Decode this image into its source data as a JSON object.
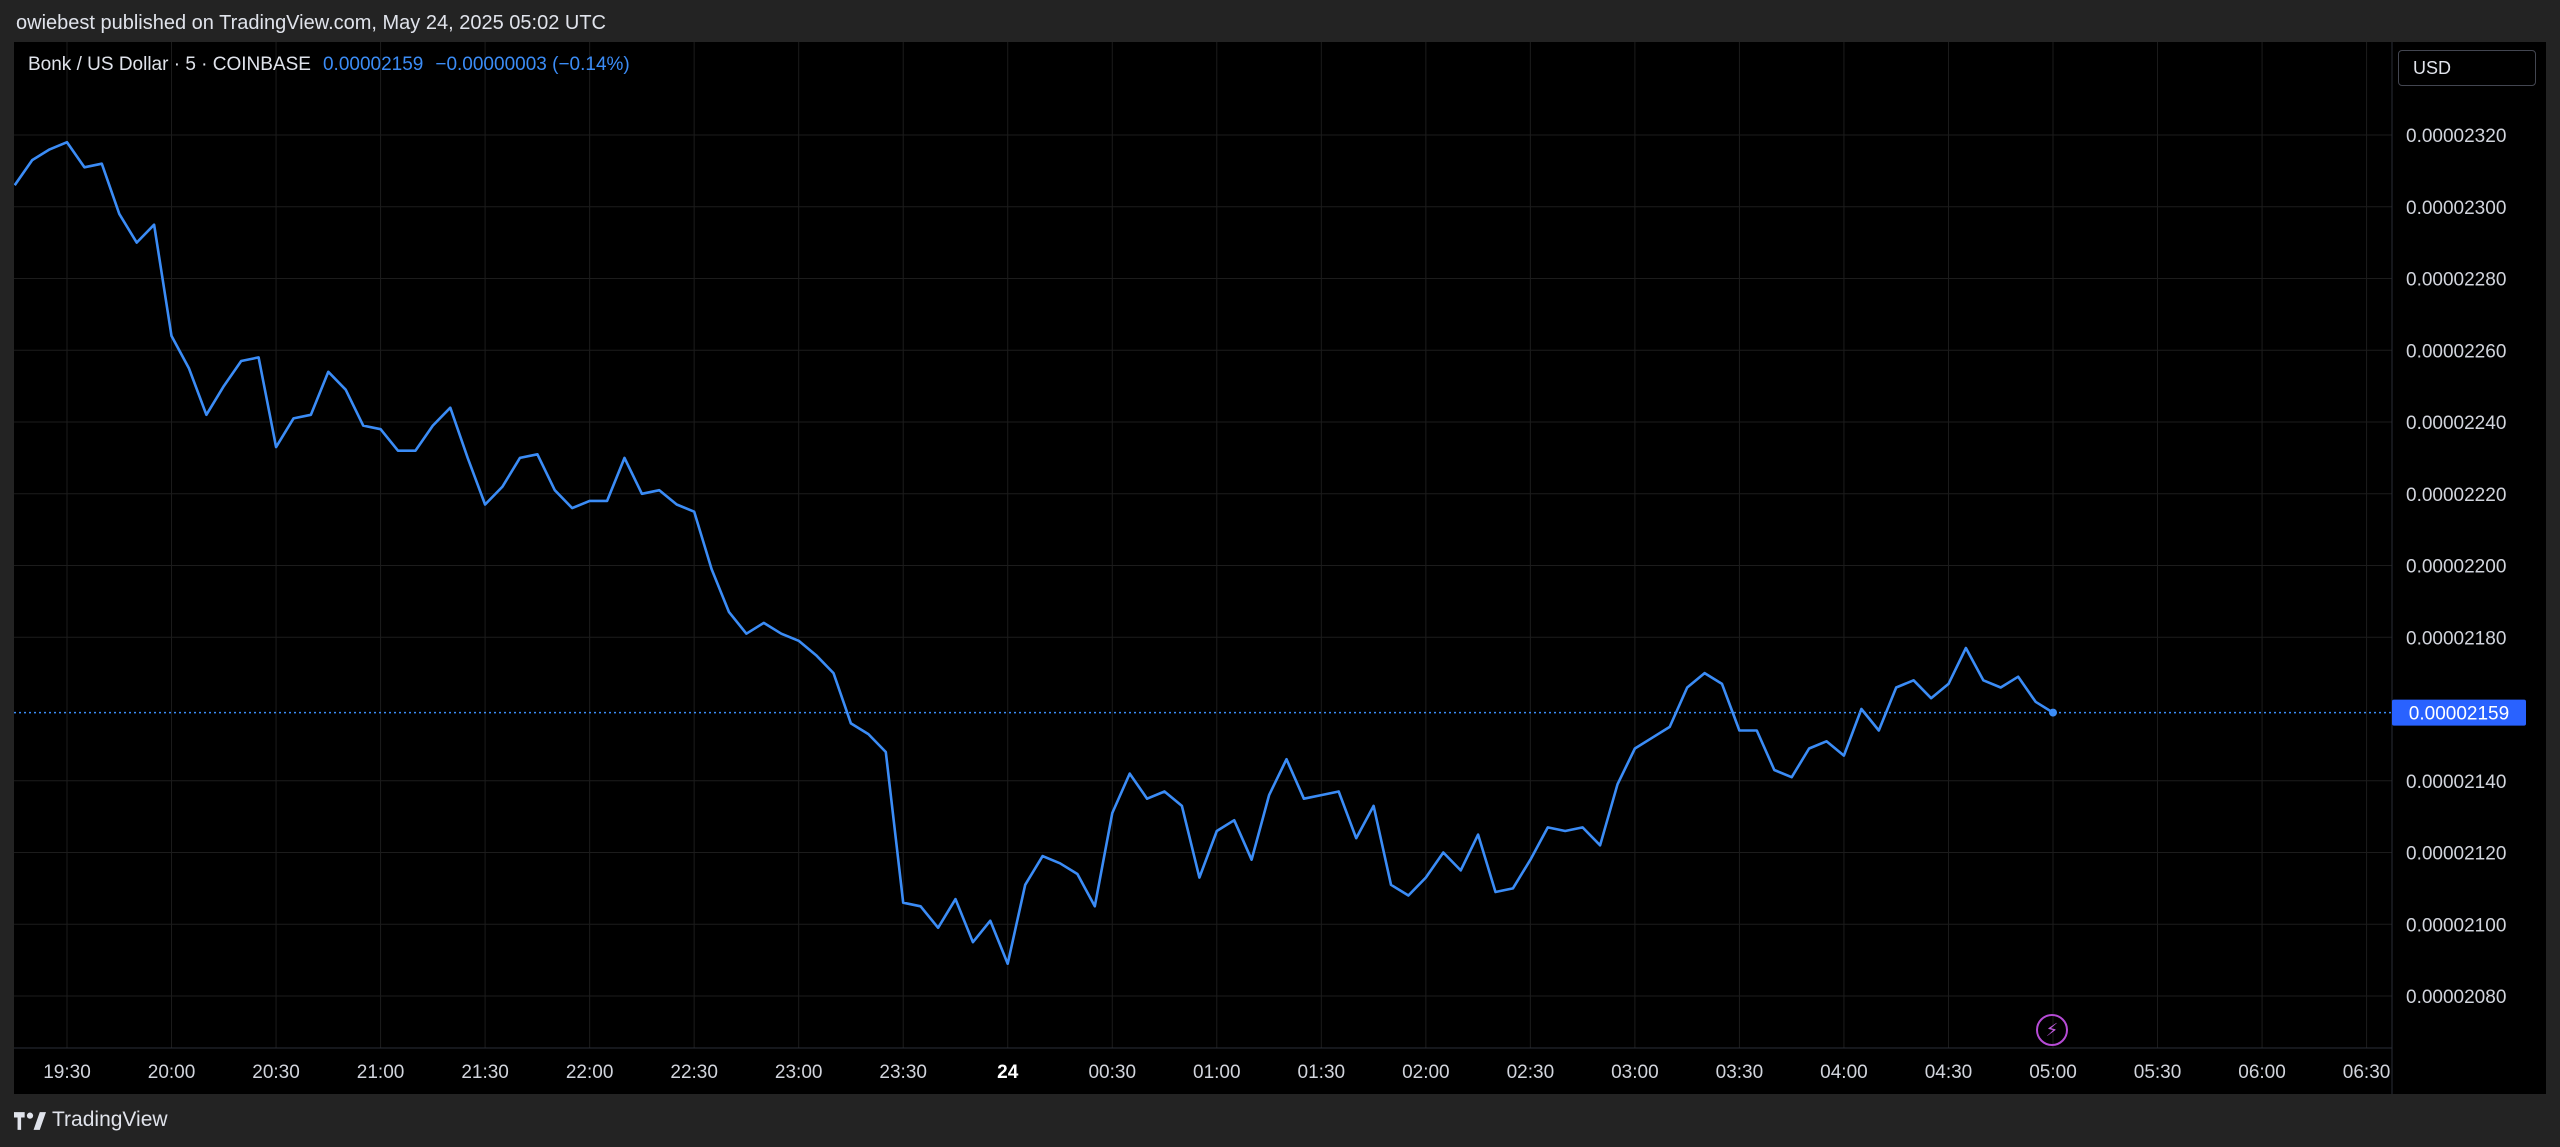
{
  "header": {
    "published_text": "owiebest published on TradingView.com, May 24, 2025 05:02 UTC"
  },
  "legend": {
    "symbol": "Bonk / US Dollar · 5 · COINBASE",
    "price": "0.00002159",
    "change": "−0.00000003 (−0.14%)"
  },
  "currency_selector": {
    "label": "USD"
  },
  "footer": {
    "brand": "TradingView"
  },
  "icons": {
    "flash": "lightning-icon",
    "logo": "tradingview-logo-icon"
  },
  "colors": {
    "line": "#3b8cf6",
    "price_tag": "#2962ff",
    "grid": "#1c1c1c",
    "flash": "#c25ce0"
  },
  "chart_data": {
    "type": "line",
    "title": "",
    "xlabel": "",
    "ylabel": "",
    "ylim": [
      2.07e-05,
      2.33e-05
    ],
    "y_ticks": [
      "0.00002320",
      "0.00002300",
      "0.00002280",
      "0.00002260",
      "0.00002240",
      "0.00002220",
      "0.00002200",
      "0.00002180",
      "0.00002140",
      "0.00002120",
      "0.00002100",
      "0.00002080"
    ],
    "y_tick_values": [
      2.32e-05,
      2.3e-05,
      2.28e-05,
      2.26e-05,
      2.24e-05,
      2.22e-05,
      2.2e-05,
      2.18e-05,
      2.14e-05,
      2.12e-05,
      2.1e-05,
      2.08e-05
    ],
    "x_ticks": [
      "19:30",
      "20:00",
      "20:30",
      "21:00",
      "21:30",
      "22:00",
      "22:30",
      "23:00",
      "23:30",
      "24",
      "00:30",
      "01:00",
      "01:30",
      "02:00",
      "02:30",
      "03:00",
      "03:30",
      "04:00",
      "04:30",
      "05:00",
      "05:30",
      "06:00",
      "06:30"
    ],
    "x_tick_minutes": [
      1170,
      1200,
      1230,
      1260,
      1290,
      1320,
      1350,
      1380,
      1410,
      1440,
      1470,
      1500,
      1530,
      1560,
      1590,
      1620,
      1650,
      1680,
      1710,
      1740,
      1770,
      1800,
      1830
    ],
    "bold_tick": "24",
    "last_price_label": "0.00002159",
    "last_price": 2.159e-05,
    "grid": true,
    "x_minutes": [
      1155,
      1160,
      1165,
      1170,
      1175,
      1180,
      1185,
      1190,
      1195,
      1200,
      1205,
      1210,
      1215,
      1220,
      1225,
      1230,
      1235,
      1240,
      1245,
      1250,
      1255,
      1260,
      1265,
      1270,
      1275,
      1280,
      1285,
      1290,
      1295,
      1300,
      1305,
      1310,
      1315,
      1320,
      1325,
      1330,
      1335,
      1340,
      1345,
      1350,
      1355,
      1360,
      1365,
      1370,
      1375,
      1380,
      1385,
      1390,
      1395,
      1400,
      1405,
      1410,
      1415,
      1420,
      1425,
      1430,
      1435,
      1440,
      1445,
      1450,
      1455,
      1460,
      1465,
      1470,
      1475,
      1480,
      1485,
      1490,
      1495,
      1500,
      1505,
      1510,
      1515,
      1520,
      1525,
      1530,
      1535,
      1540,
      1545,
      1550,
      1555,
      1560,
      1565,
      1570,
      1575,
      1580,
      1585,
      1590,
      1595,
      1600,
      1605,
      1610,
      1615,
      1620,
      1625,
      1630,
      1635,
      1640,
      1645,
      1650,
      1655,
      1660,
      1665,
      1670,
      1675,
      1680,
      1685,
      1690,
      1695,
      1700,
      1705,
      1710,
      1715,
      1720,
      1725,
      1730,
      1735,
      1740
    ],
    "values": [
      2.306e-05,
      2.313e-05,
      2.316e-05,
      2.318e-05,
      2.311e-05,
      2.312e-05,
      2.298e-05,
      2.29e-05,
      2.295e-05,
      2.264e-05,
      2.255e-05,
      2.242e-05,
      2.25e-05,
      2.257e-05,
      2.258e-05,
      2.233e-05,
      2.241e-05,
      2.242e-05,
      2.254e-05,
      2.249e-05,
      2.239e-05,
      2.238e-05,
      2.232e-05,
      2.232e-05,
      2.239e-05,
      2.244e-05,
      2.23e-05,
      2.217e-05,
      2.222e-05,
      2.23e-05,
      2.231e-05,
      2.221e-05,
      2.216e-05,
      2.218e-05,
      2.218e-05,
      2.23e-05,
      2.22e-05,
      2.221e-05,
      2.217e-05,
      2.215e-05,
      2.199e-05,
      2.187e-05,
      2.181e-05,
      2.184e-05,
      2.181e-05,
      2.179e-05,
      2.175e-05,
      2.17e-05,
      2.156e-05,
      2.153e-05,
      2.148e-05,
      2.106e-05,
      2.105e-05,
      2.099e-05,
      2.107e-05,
      2.095e-05,
      2.101e-05,
      2.089e-05,
      2.111e-05,
      2.119e-05,
      2.117e-05,
      2.114e-05,
      2.105e-05,
      2.131e-05,
      2.142e-05,
      2.135e-05,
      2.137e-05,
      2.133e-05,
      2.113e-05,
      2.126e-05,
      2.129e-05,
      2.118e-05,
      2.136e-05,
      2.146e-05,
      2.135e-05,
      2.136e-05,
      2.137e-05,
      2.124e-05,
      2.133e-05,
      2.111e-05,
      2.108e-05,
      2.113e-05,
      2.12e-05,
      2.115e-05,
      2.125e-05,
      2.109e-05,
      2.11e-05,
      2.118e-05,
      2.127e-05,
      2.126e-05,
      2.127e-05,
      2.122e-05,
      2.139e-05,
      2.149e-05,
      2.152e-05,
      2.155e-05,
      2.166e-05,
      2.17e-05,
      2.167e-05,
      2.154e-05,
      2.154e-05,
      2.143e-05,
      2.141e-05,
      2.149e-05,
      2.151e-05,
      2.147e-05,
      2.16e-05,
      2.154e-05,
      2.166e-05,
      2.168e-05,
      2.163e-05,
      2.167e-05,
      2.177e-05,
      2.168e-05,
      2.166e-05,
      2.169e-05,
      2.162e-05,
      2.159e-05
    ]
  }
}
